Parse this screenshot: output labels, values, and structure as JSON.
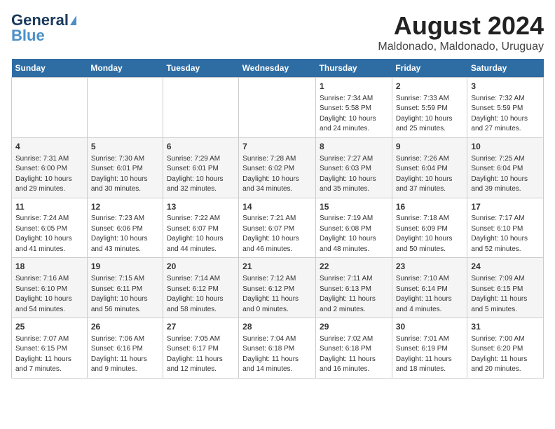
{
  "header": {
    "logo_general": "General",
    "logo_blue": "Blue",
    "month_year": "August 2024",
    "location": "Maldonado, Maldonado, Uruguay"
  },
  "days_of_week": [
    "Sunday",
    "Monday",
    "Tuesday",
    "Wednesday",
    "Thursday",
    "Friday",
    "Saturday"
  ],
  "weeks": [
    [
      {
        "day": "",
        "info": ""
      },
      {
        "day": "",
        "info": ""
      },
      {
        "day": "",
        "info": ""
      },
      {
        "day": "",
        "info": ""
      },
      {
        "day": "1",
        "info": "Sunrise: 7:34 AM\nSunset: 5:58 PM\nDaylight: 10 hours and 24 minutes."
      },
      {
        "day": "2",
        "info": "Sunrise: 7:33 AM\nSunset: 5:59 PM\nDaylight: 10 hours and 25 minutes."
      },
      {
        "day": "3",
        "info": "Sunrise: 7:32 AM\nSunset: 5:59 PM\nDaylight: 10 hours and 27 minutes."
      }
    ],
    [
      {
        "day": "4",
        "info": "Sunrise: 7:31 AM\nSunset: 6:00 PM\nDaylight: 10 hours and 29 minutes."
      },
      {
        "day": "5",
        "info": "Sunrise: 7:30 AM\nSunset: 6:01 PM\nDaylight: 10 hours and 30 minutes."
      },
      {
        "day": "6",
        "info": "Sunrise: 7:29 AM\nSunset: 6:01 PM\nDaylight: 10 hours and 32 minutes."
      },
      {
        "day": "7",
        "info": "Sunrise: 7:28 AM\nSunset: 6:02 PM\nDaylight: 10 hours and 34 minutes."
      },
      {
        "day": "8",
        "info": "Sunrise: 7:27 AM\nSunset: 6:03 PM\nDaylight: 10 hours and 35 minutes."
      },
      {
        "day": "9",
        "info": "Sunrise: 7:26 AM\nSunset: 6:04 PM\nDaylight: 10 hours and 37 minutes."
      },
      {
        "day": "10",
        "info": "Sunrise: 7:25 AM\nSunset: 6:04 PM\nDaylight: 10 hours and 39 minutes."
      }
    ],
    [
      {
        "day": "11",
        "info": "Sunrise: 7:24 AM\nSunset: 6:05 PM\nDaylight: 10 hours and 41 minutes."
      },
      {
        "day": "12",
        "info": "Sunrise: 7:23 AM\nSunset: 6:06 PM\nDaylight: 10 hours and 43 minutes."
      },
      {
        "day": "13",
        "info": "Sunrise: 7:22 AM\nSunset: 6:07 PM\nDaylight: 10 hours and 44 minutes."
      },
      {
        "day": "14",
        "info": "Sunrise: 7:21 AM\nSunset: 6:07 PM\nDaylight: 10 hours and 46 minutes."
      },
      {
        "day": "15",
        "info": "Sunrise: 7:19 AM\nSunset: 6:08 PM\nDaylight: 10 hours and 48 minutes."
      },
      {
        "day": "16",
        "info": "Sunrise: 7:18 AM\nSunset: 6:09 PM\nDaylight: 10 hours and 50 minutes."
      },
      {
        "day": "17",
        "info": "Sunrise: 7:17 AM\nSunset: 6:10 PM\nDaylight: 10 hours and 52 minutes."
      }
    ],
    [
      {
        "day": "18",
        "info": "Sunrise: 7:16 AM\nSunset: 6:10 PM\nDaylight: 10 hours and 54 minutes."
      },
      {
        "day": "19",
        "info": "Sunrise: 7:15 AM\nSunset: 6:11 PM\nDaylight: 10 hours and 56 minutes."
      },
      {
        "day": "20",
        "info": "Sunrise: 7:14 AM\nSunset: 6:12 PM\nDaylight: 10 hours and 58 minutes."
      },
      {
        "day": "21",
        "info": "Sunrise: 7:12 AM\nSunset: 6:12 PM\nDaylight: 11 hours and 0 minutes."
      },
      {
        "day": "22",
        "info": "Sunrise: 7:11 AM\nSunset: 6:13 PM\nDaylight: 11 hours and 2 minutes."
      },
      {
        "day": "23",
        "info": "Sunrise: 7:10 AM\nSunset: 6:14 PM\nDaylight: 11 hours and 4 minutes."
      },
      {
        "day": "24",
        "info": "Sunrise: 7:09 AM\nSunset: 6:15 PM\nDaylight: 11 hours and 5 minutes."
      }
    ],
    [
      {
        "day": "25",
        "info": "Sunrise: 7:07 AM\nSunset: 6:15 PM\nDaylight: 11 hours and 7 minutes."
      },
      {
        "day": "26",
        "info": "Sunrise: 7:06 AM\nSunset: 6:16 PM\nDaylight: 11 hours and 9 minutes."
      },
      {
        "day": "27",
        "info": "Sunrise: 7:05 AM\nSunset: 6:17 PM\nDaylight: 11 hours and 12 minutes."
      },
      {
        "day": "28",
        "info": "Sunrise: 7:04 AM\nSunset: 6:18 PM\nDaylight: 11 hours and 14 minutes."
      },
      {
        "day": "29",
        "info": "Sunrise: 7:02 AM\nSunset: 6:18 PM\nDaylight: 11 hours and 16 minutes."
      },
      {
        "day": "30",
        "info": "Sunrise: 7:01 AM\nSunset: 6:19 PM\nDaylight: 11 hours and 18 minutes."
      },
      {
        "day": "31",
        "info": "Sunrise: 7:00 AM\nSunset: 6:20 PM\nDaylight: 11 hours and 20 minutes."
      }
    ]
  ]
}
